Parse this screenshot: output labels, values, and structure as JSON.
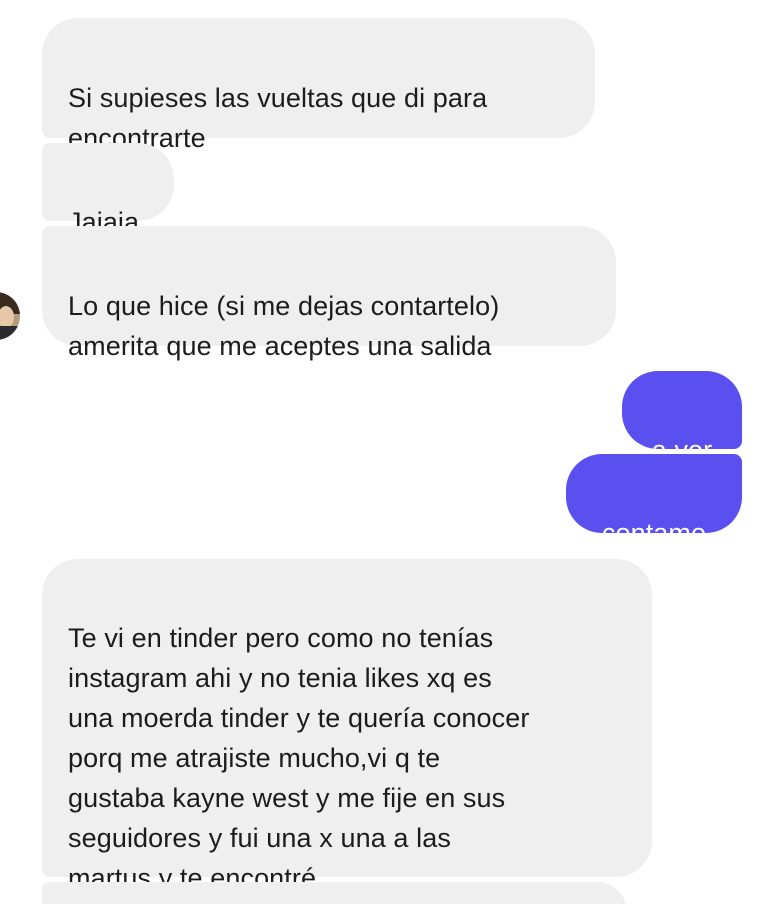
{
  "conversation": {
    "messages": [
      {
        "sender": "them",
        "text": "Si supieses las vueltas que di para\nencontrarte"
      },
      {
        "sender": "them",
        "text": "Jajaja"
      },
      {
        "sender": "them",
        "text": "Lo que hice (si me dejas contartelo)\namerita que me aceptes una salida"
      },
      {
        "sender": "me",
        "text": "a ver"
      },
      {
        "sender": "me",
        "text": "contame"
      },
      {
        "sender": "them",
        "text": "Te vi en tinder pero como no tenías\ninstagram ahi y no tenia likes xq es\nuna moerda tinder y te quería conocer\nporq me atrajiste mucho,vi q te\ngustaba kayne west y me fije en sus\nseguidores y fui una x una a las\nmartus y te encontré"
      },
      {
        "sender": "them",
        "text": ""
      }
    ]
  },
  "colors": {
    "incoming_bubble": "#efefef",
    "outgoing_bubble": "#5a50f0",
    "incoming_text": "#1c1c1c",
    "outgoing_text": "#ffffff"
  },
  "icons": {
    "avatar": "contact-avatar"
  }
}
